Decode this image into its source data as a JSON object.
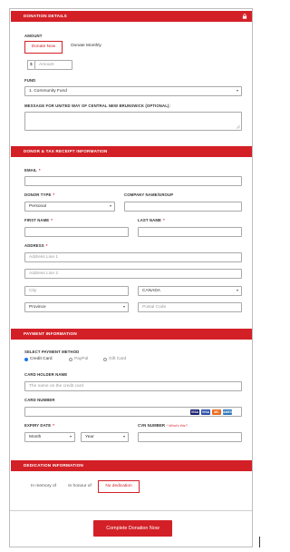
{
  "donation_details": {
    "header": "DONATION DETAILS",
    "amount_label": "AMOUNT",
    "tab_now": "Donate Now",
    "tab_monthly": "Donate Monthly",
    "currency_symbol": "$",
    "amount_placeholder": "Amount",
    "fund_label": "FUND",
    "fund_value": "1. Community Fund",
    "message_label": "MESSAGE FOR UNITED WAY OF CENTRAL NEW BRUNSWICK (OPTIONAL):"
  },
  "donor": {
    "header": "DONOR & TAX RECEIPT INFORMATION",
    "email_label": "EMAIL",
    "donor_type_label": "DONOR TYPE",
    "donor_type_value": "Personal",
    "company_label": "COMPANY NAME/GROUP",
    "first_name_label": "FIRST NAME",
    "last_name_label": "LAST NAME",
    "address_label": "ADDRESS",
    "address1_placeholder": "Address Line 1",
    "address2_placeholder": "Address Line 2",
    "city_placeholder": "City",
    "country_value": "CANADA",
    "province_value": "Province",
    "postal_placeholder": "Postal Code",
    "required_mark": "*"
  },
  "payment": {
    "header": "PAYMENT INFORMATION",
    "method_label": "SELECT PAYMENT METHOD",
    "methods": [
      "Credit Card",
      "PayPal",
      "Gift Card"
    ],
    "holder_label": "CARD HOLDER NAME",
    "holder_placeholder": "The name on the credit card",
    "number_label": "CARD NUMBER",
    "cards": [
      "VISA",
      "VISA",
      "MC",
      "AMEX"
    ],
    "expiry_label": "EXPIRY DATE",
    "month_value": "Month",
    "year_value": "Year",
    "cvn_label": "CVN NUMBER",
    "cvn_hint": "* What's this?"
  },
  "dedication": {
    "header": "DEDICATION INFORMATION",
    "options": [
      "In memory of",
      "In honour of",
      "No dedication"
    ]
  },
  "submit_label": "Complete Donation Now",
  "colors": {
    "accent": "#d32027",
    "border": "#a9a9a9",
    "text": "#333333"
  }
}
